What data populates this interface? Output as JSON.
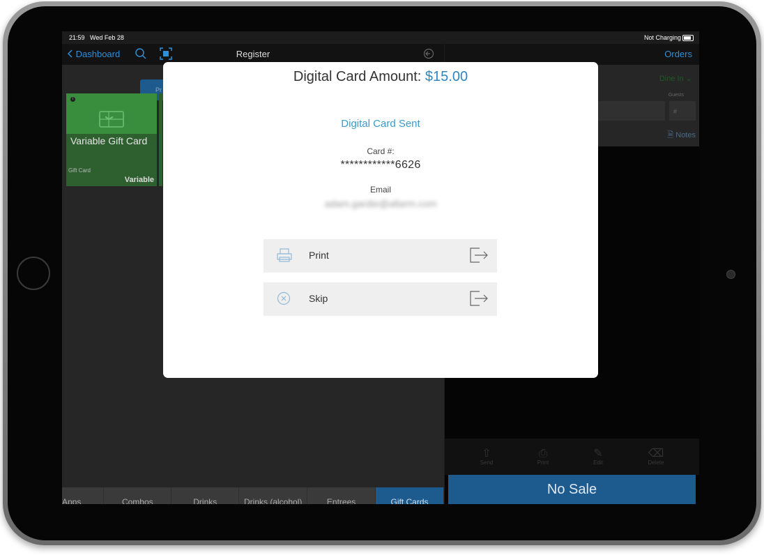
{
  "status": {
    "time": "21:59",
    "date": "Wed Feb 28",
    "charging": "Not Charging"
  },
  "left": {
    "back_label": "Dashboard",
    "title": "Register",
    "pill_label": "Pr",
    "tile": {
      "name": "Variable Gift Card",
      "category": "Gift Card",
      "price": "Variable",
      "info": "i"
    },
    "categories": [
      {
        "label": "Apps"
      },
      {
        "label": "Combos"
      },
      {
        "label": "Drinks"
      },
      {
        "label": "Drinks (alcohol)"
      },
      {
        "label": "Entrees"
      },
      {
        "label": "Gift Cards",
        "active": true
      }
    ]
  },
  "right": {
    "orders_label": "Orders",
    "dine_in": "Dine In",
    "guests_label": "Guests",
    "guests_placeholder": "#",
    "notes_label": "Notes",
    "actions": [
      "Send",
      "Print",
      "Edit",
      "Delete"
    ],
    "no_sale": "No Sale"
  },
  "modal": {
    "title_prefix": "Digital Card Amount:",
    "amount": "$15.00",
    "sent_label": "Digital Card Sent",
    "card_label": "Card #:",
    "card_value": "************6626",
    "email_label": "Email",
    "email_value": "adam.gardie@allarm.com",
    "print_label": "Print",
    "skip_label": "Skip"
  },
  "colors": {
    "accent": "#2e86c1",
    "brand_blue": "#1d5a8e",
    "tile_green": "#388e3c"
  },
  "icons": [
    "chevron-left-icon",
    "search-icon",
    "scan-icon",
    "logout-icon",
    "gift-icon",
    "printer-icon",
    "cancel-circle-icon",
    "exit-arrow-icon",
    "send-icon",
    "edit-icon",
    "trash-icon",
    "notes-icon"
  ]
}
